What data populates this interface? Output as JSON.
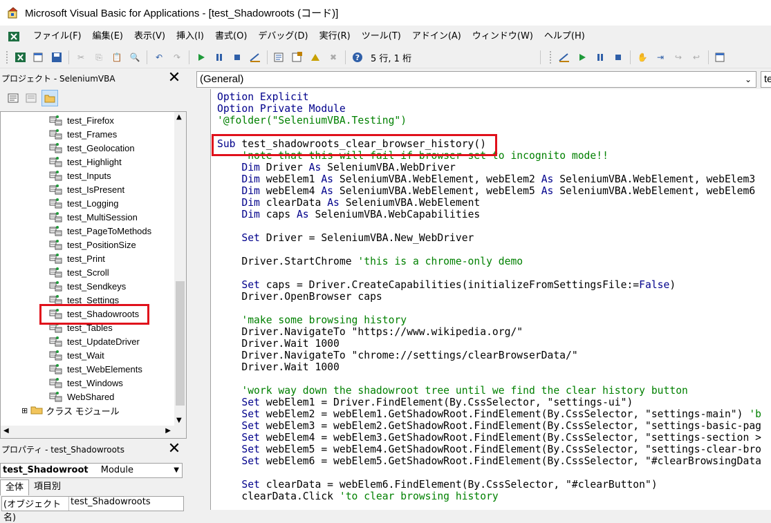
{
  "window": {
    "title": "Microsoft Visual Basic for Applications - [test_Shadowroots (コード)]"
  },
  "menu": [
    "ファイル(F)",
    "編集(E)",
    "表示(V)",
    "挿入(I)",
    "書式(O)",
    "デバッグ(D)",
    "実行(R)",
    "ツール(T)",
    "アドイン(A)",
    "ウィンドウ(W)",
    "ヘルプ(H)"
  ],
  "toolbar": {
    "position": "5 行, 1 桁"
  },
  "project": {
    "title": "プロジェクト - SeleniumVBA",
    "items": [
      "test_Firefox",
      "test_Frames",
      "test_Geolocation",
      "test_Highlight",
      "test_Inputs",
      "test_IsPresent",
      "test_Logging",
      "test_MultiSession",
      "test_PageToMethods",
      "test_PositionSize",
      "test_Print",
      "test_Scroll",
      "test_Sendkeys",
      "test_Settings",
      "test_Shadowroots",
      "test_Tables",
      "test_UpdateDriver",
      "test_Wait",
      "test_WebElements",
      "test_Windows",
      "WebShared"
    ],
    "selected": "test_Shadowroots",
    "folder": "クラス モジュール"
  },
  "properties": {
    "title": "プロパティ - test_Shadowroots",
    "object_name": "test_Shadowroot",
    "object_type": "Module",
    "tabs": [
      "全体",
      "項目別"
    ],
    "row_label": "(オブジェクト名)",
    "row_value": "test_Shadowroots"
  },
  "code": {
    "object_combo": "(General)",
    "proc_combo": "te",
    "lines": [
      "Option Explicit",
      "Option Private Module",
      "'@folder(\"SeleniumVBA.Testing\")",
      "",
      "Sub test_shadowroots_clear_browser_history()",
      "    'note that this will fail if browser set to incognito mode!!",
      "    Dim Driver As SeleniumVBA.WebDriver",
      "    Dim webElem1 As SeleniumVBA.WebElement, webElem2 As SeleniumVBA.WebElement, webElem3",
      "    Dim webElem4 As SeleniumVBA.WebElement, webElem5 As SeleniumVBA.WebElement, webElem6",
      "    Dim clearData As SeleniumVBA.WebElement",
      "    Dim caps As SeleniumVBA.WebCapabilities",
      "",
      "    Set Driver = SeleniumVBA.New_WebDriver",
      "",
      "    Driver.StartChrome 'this is a chrome-only demo",
      "",
      "    Set caps = Driver.CreateCapabilities(initializeFromSettingsFile:=False)",
      "    Driver.OpenBrowser caps",
      "",
      "    'make some browsing history",
      "    Driver.NavigateTo \"https://www.wikipedia.org/\"",
      "    Driver.Wait 1000",
      "    Driver.NavigateTo \"chrome://settings/clearBrowserData/\"",
      "    Driver.Wait 1000",
      "",
      "    'work way down the shadowroot tree until we find the clear history button",
      "    Set webElem1 = Driver.FindElement(By.CssSelector, \"settings-ui\")",
      "    Set webElem2 = webElem1.GetShadowRoot.FindElement(By.CssSelector, \"settings-main\") 'b",
      "    Set webElem3 = webElem2.GetShadowRoot.FindElement(By.CssSelector, \"settings-basic-pag",
      "    Set webElem4 = webElem3.GetShadowRoot.FindElement(By.CssSelector, \"settings-section >",
      "    Set webElem5 = webElem4.GetShadowRoot.FindElement(By.CssSelector, \"settings-clear-bro",
      "    Set webElem6 = webElem5.GetShadowRoot.FindElement(By.CssSelector, \"#clearBrowsingData",
      "",
      "    Set clearData = webElem6.FindElement(By.CssSelector, \"#clearButton\")",
      "    clearData.Click 'to clear browsing history"
    ]
  },
  "colors": {
    "keyword": "#00008b",
    "comment": "#008000",
    "highlight": "#e0101b"
  }
}
